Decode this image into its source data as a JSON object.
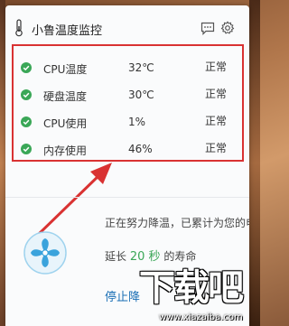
{
  "app": {
    "title": "小鲁温度监控"
  },
  "metrics": [
    {
      "name": "CPU温度",
      "value": "32℃",
      "status": "正常"
    },
    {
      "name": "硬盘温度",
      "value": "30℃",
      "status": "正常"
    },
    {
      "name": "CPU使用",
      "value": "1%",
      "status": "正常"
    },
    {
      "name": "内存使用",
      "value": "46%",
      "status": "正常"
    }
  ],
  "cooling": {
    "line1": "正在努力降温，已累计为您的电脑",
    "line2_prefix": "延长",
    "line2_seconds": "20 秒",
    "line2_suffix": "的寿命",
    "stop_label": "停止降"
  },
  "watermark": {
    "logo_text": "下载吧",
    "url": "www.xiazaiba.com"
  },
  "colors": {
    "accent": "#1a6fb5",
    "ok": "#3aa757",
    "highlight": "#d93232"
  }
}
